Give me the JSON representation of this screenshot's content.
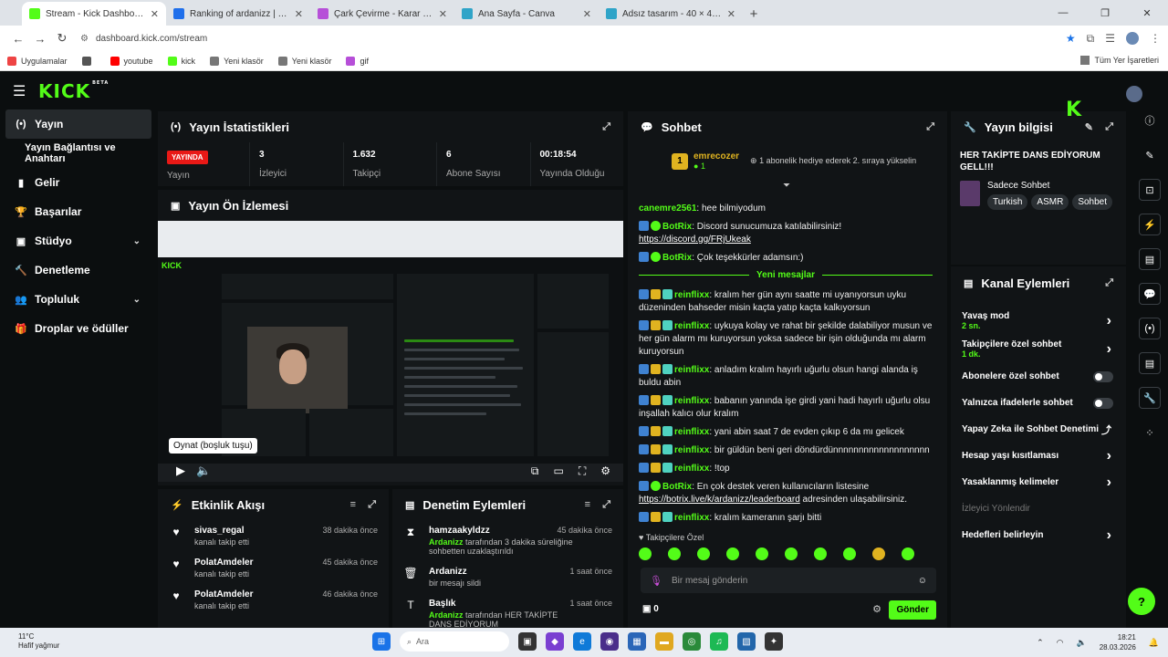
{
  "browser": {
    "tabs": [
      {
        "label": "Stream - Kick Dashboard",
        "color": "#53fc18",
        "active": true
      },
      {
        "label": "Ranking of ardanizz | BotRix —",
        "color": "#1f6feb",
        "active": false
      },
      {
        "label": "Çark Çevirme - Karar Çarkı",
        "color": "#b64fd8",
        "active": false
      },
      {
        "label": "Ana Sayfa - Canva",
        "color": "#2fa4c8",
        "active": false
      },
      {
        "label": "Adsız tasarım - 40 × 40 px",
        "color": "#2fa4c8",
        "active": false
      }
    ],
    "url": "dashboard.kick.com/stream",
    "bookmarks": [
      {
        "label": "Uygulamalar",
        "color": "#e44"
      },
      {
        "label": "",
        "color": "#555"
      },
      {
        "label": "youtube",
        "color": "#f00"
      },
      {
        "label": "kick",
        "color": "#53fc18"
      },
      {
        "label": "Yeni klasör",
        "color": "#777"
      },
      {
        "label": "Yeni klasör",
        "color": "#777"
      },
      {
        "label": "gif",
        "color": "#b64fd8"
      }
    ],
    "all_bookmarks": "Tüm Yer İşaretleri"
  },
  "sidebar": {
    "items": [
      {
        "label": "Yayın",
        "icon": "broadcast-icon",
        "active": true
      },
      {
        "label": "Yayın Bağlantısı ve Anahtarı",
        "icon": "",
        "sub": true
      },
      {
        "label": "Gelir",
        "icon": "chart-icon"
      },
      {
        "label": "Başarılar",
        "icon": "trophy-icon"
      },
      {
        "label": "Stüdyo",
        "icon": "studio-icon",
        "chev": true
      },
      {
        "label": "Denetleme",
        "icon": "hammer-icon"
      },
      {
        "label": "Topluluk",
        "icon": "community-icon",
        "chev": true
      },
      {
        "label": "Droplar ve ödüller",
        "icon": "gift-icon"
      }
    ]
  },
  "stats": {
    "title": "Yayın İstatistikleri",
    "live": "YAYINDA",
    "live_label": "Yayın",
    "items": [
      {
        "value": "3",
        "label": "İzleyici"
      },
      {
        "value": "1.632",
        "label": "Takipçi"
      },
      {
        "value": "6",
        "label": "Abone Sayısı"
      },
      {
        "value": "00:18:54",
        "label": "Yayında Olduğu"
      }
    ]
  },
  "preview": {
    "title": "Yayın Ön İzlemesi",
    "tooltip": "Oynat (boşluk tuşu)"
  },
  "activity": {
    "title": "Etkinlik Akışı",
    "items": [
      {
        "name": "sivas_regal",
        "desc": "kanalı takip etti",
        "time": "38 dakika önce"
      },
      {
        "name": "PolatAmdeler",
        "desc": "kanalı takip etti",
        "time": "45 dakika önce"
      },
      {
        "name": "PolatAmdeler",
        "desc": "kanalı takip etti",
        "time": "46 dakika önce"
      }
    ]
  },
  "moderation": {
    "title": "Denetim Eylemleri",
    "items": [
      {
        "name": "hamzaakyldzz",
        "actor": "Ardanizz",
        "desc": " tarafından 3 dakika süreliğine sohbetten uzaklaştırıldı",
        "time": "45 dakika önce"
      },
      {
        "name": "Ardanizz",
        "actor": "",
        "desc": "bir mesajı sildi",
        "time": "1 saat önce"
      },
      {
        "name": "Başlık",
        "actor": "Ardanizz",
        "desc": " tarafından HER TAKİPTE DANS EDİYORUM",
        "time": "1 saat önce"
      }
    ]
  },
  "chat": {
    "title": "Sohbet",
    "pinned_user": "emrecozer",
    "pinned_count": "1",
    "pinned_text": "1 abonelik hediye ederek 2. sıraya yükselin",
    "new_messages": "Yeni mesajlar",
    "messages": [
      {
        "user": "canemre2561",
        "color": "#53fc18",
        "text": "hee bilmiyodum",
        "badges": []
      },
      {
        "user": "BotRix",
        "color": "#53fc18",
        "text": "Discord sunucumuza katılabilirsiniz!",
        "link": "https://discord.gg/FRjUkeak",
        "badges": [
          "bot",
          "ver"
        ]
      },
      {
        "user": "BotRix",
        "color": "#53fc18",
        "text": "Çok teşekkürler adamsın:)",
        "badges": [
          "bot",
          "ver"
        ]
      }
    ],
    "messages2": [
      {
        "user": "reinflixx",
        "text": "kralım her gün aynı saatte mi uyanıyorsun uyku düzeninden bahseder misin kaçta yatıp kaçta kalkıyorsun"
      },
      {
        "user": "reinflixx",
        "text": "uykuya kolay ve rahat bir şekilde dalabiliyor musun ve her gün alarm mı kuruyorsun yoksa sadece bir işin olduğunda mı alarm kuruyorsun"
      },
      {
        "user": "reinflixx",
        "text": "anladım kralım hayırlı uğurlu olsun hangi alanda iş buldu abin"
      },
      {
        "user": "reinflixx",
        "text": "babanın yanında işe girdi yani hadi hayırlı uğurlu olsu inşallah kalıcı olur kralım"
      },
      {
        "user": "reinflixx",
        "text": "yani abin saat 7 de evden çıkıp 6 da mı gelicek"
      },
      {
        "user": "reinflixx",
        "text": "bir güldün beni geri döndürdünnnnnnnnnnnnnnnnnnn"
      },
      {
        "user": "reinflixx",
        "text": "!top"
      }
    ],
    "botrix2_user": "BotRix",
    "botrix2_text": "En çok destek veren kullanıcıların listesine",
    "botrix2_link": "https://botrix.live/k/ardanizz/leaderboard",
    "botrix2_tail": " adresinden ulaşabilirsiniz.",
    "last_user": "reinflixx",
    "last_text": "kralım kameranın şarjı bitti",
    "followers_only": "Takipçilere Özel",
    "placeholder": "Bir mesaj gönderin",
    "send": "Gönder",
    "count": "0"
  },
  "info": {
    "title": "Yayın bilgisi",
    "stream_title": "HER TAKİPTE DANS EDİYORUM GELL!!!",
    "category": "Sadece Sohbet",
    "tags": [
      "Turkish",
      "ASMR",
      "Sohbet"
    ]
  },
  "channel_actions": {
    "title": "Kanal Eylemleri",
    "rows": [
      {
        "label": "Yavaş mod",
        "sub": "2 sn.",
        "kind": "arrow"
      },
      {
        "label": "Takipçilere özel sohbet",
        "sub": "1 dk.",
        "kind": "arrow"
      },
      {
        "label": "Abonelere özel sohbet",
        "sub": "",
        "kind": "toggle"
      },
      {
        "label": "Yalnızca ifadelerle sohbet",
        "sub": "",
        "kind": "toggle"
      },
      {
        "label": "Yapay Zeka ile Sohbet Denetimi",
        "sub": "",
        "kind": "ext"
      },
      {
        "label": "Hesap yaşı kısıtlaması",
        "sub": "",
        "kind": "arrow"
      },
      {
        "label": "Yasaklanmış kelimeler",
        "sub": "",
        "kind": "arrow"
      },
      {
        "label": "İzleyici Yönlendir",
        "sub": "",
        "kind": "dim"
      },
      {
        "label": "Hedefleri belirleyin",
        "sub": "",
        "kind": "arrow"
      }
    ]
  },
  "taskbar": {
    "temp": "11°C",
    "weather": "Hafif yağmur",
    "search": "Ara",
    "time": "18:21",
    "date": "28.03.2026"
  }
}
